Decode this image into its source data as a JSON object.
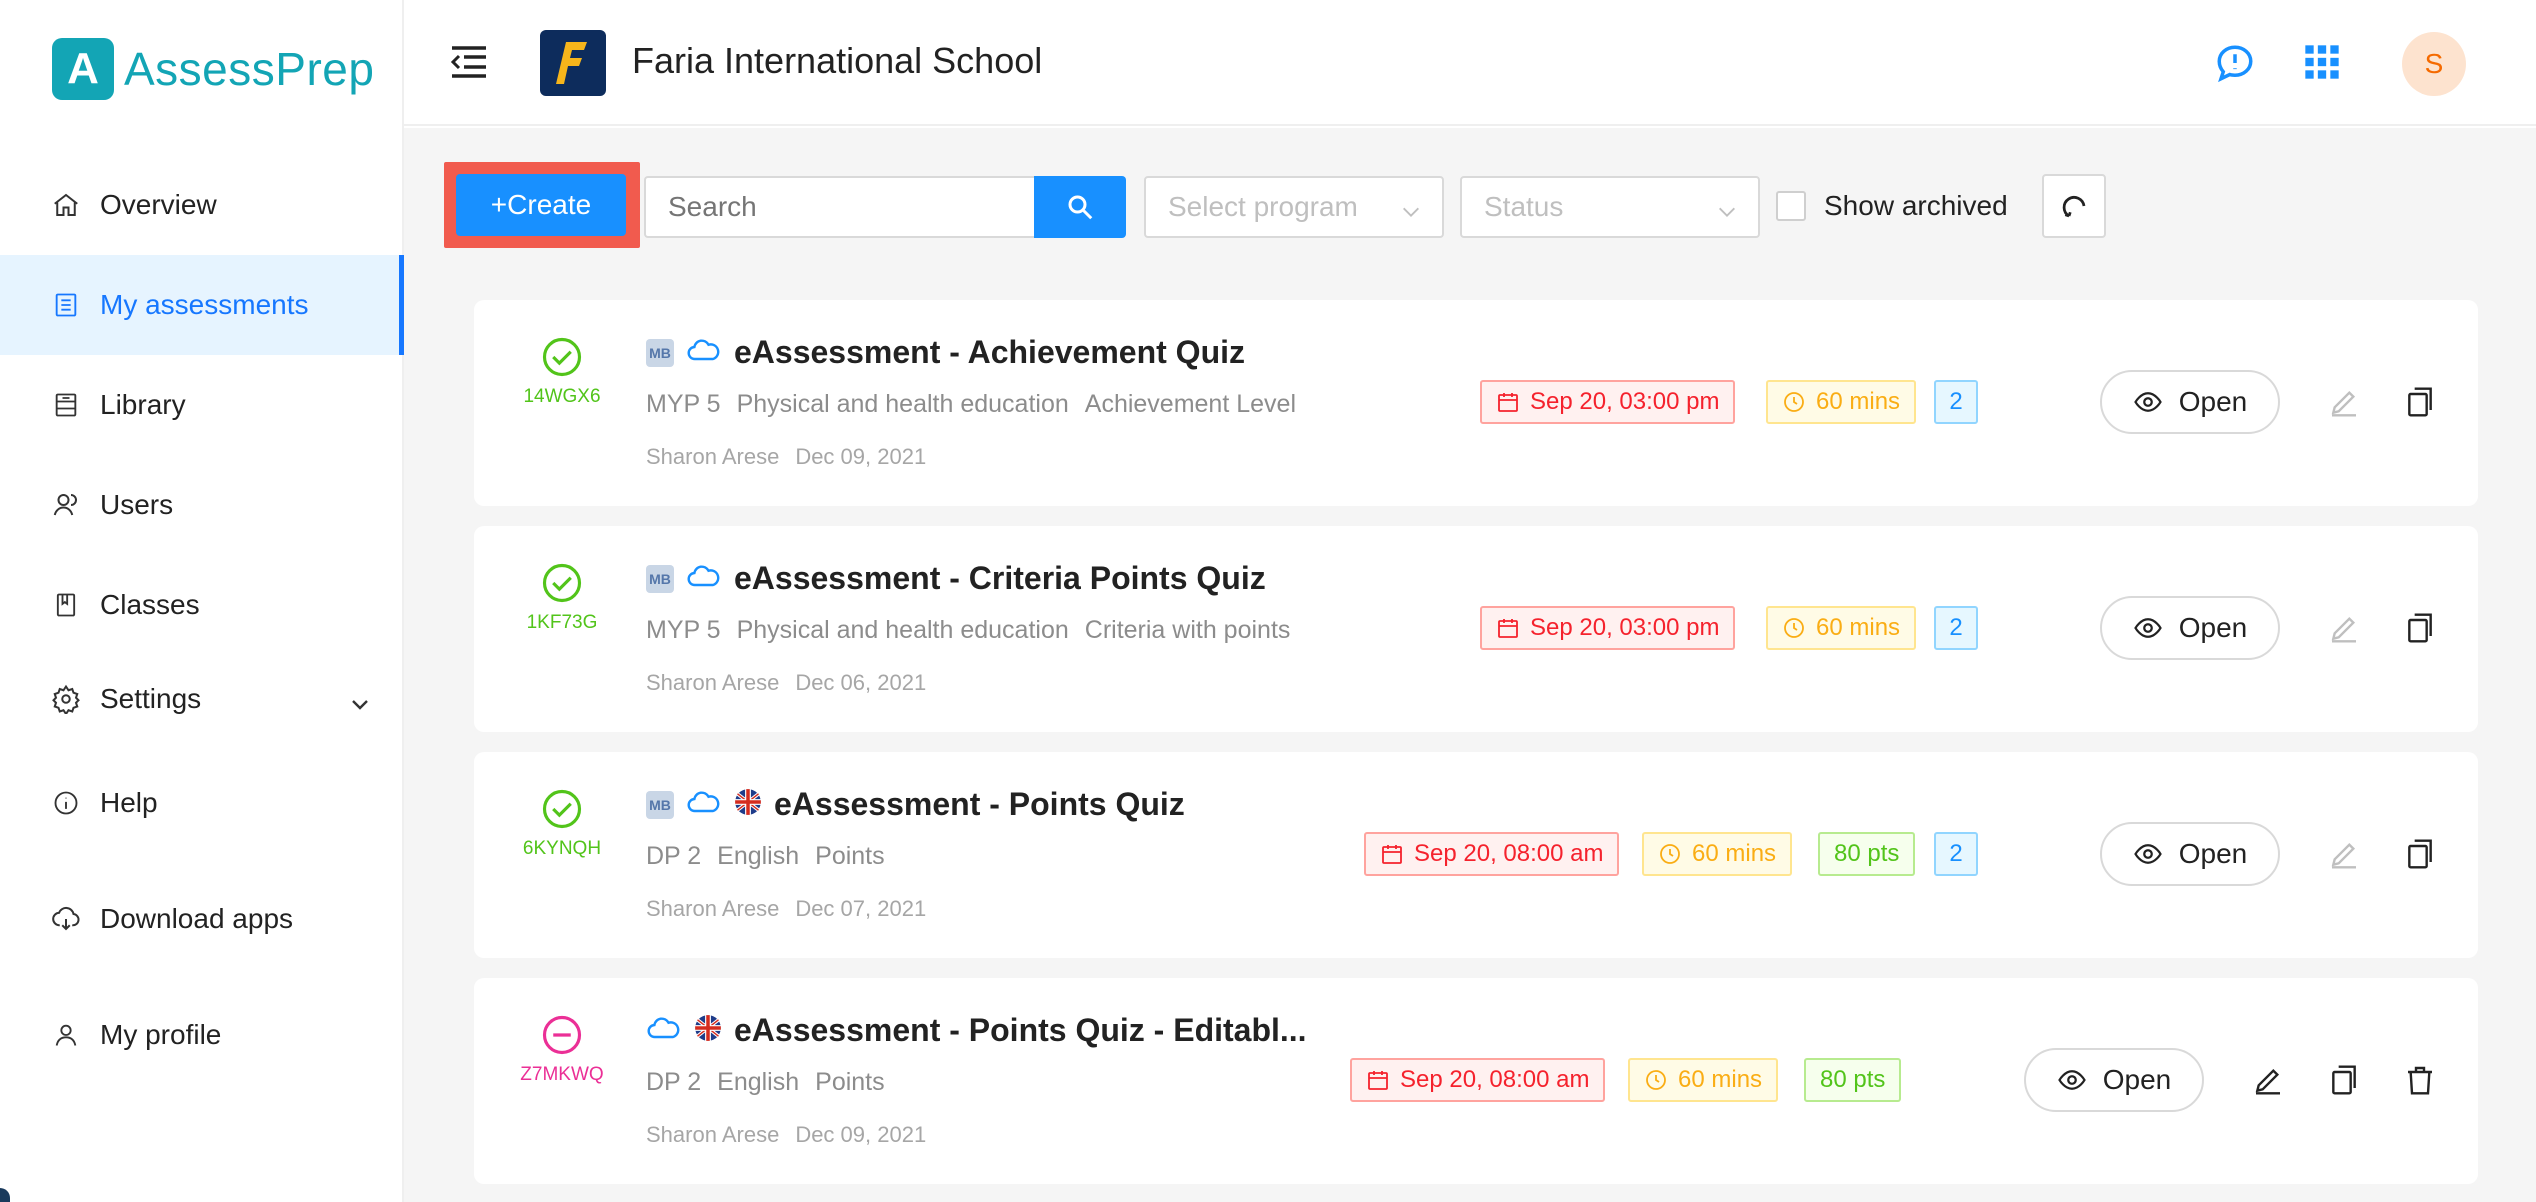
{
  "app": {
    "logo_letter": "A",
    "logo_text": "AssessPrep",
    "brand_color": "#13a5b5",
    "accent_color": "#1890ff"
  },
  "header": {
    "school_name": "Faria International School",
    "school_logo_letter": "F",
    "avatar_initial": "S"
  },
  "sidebar": {
    "items": [
      {
        "label": "Overview",
        "icon": "home-icon",
        "active": false
      },
      {
        "label": "My assessments",
        "icon": "list-icon",
        "active": true
      },
      {
        "label": "Library",
        "icon": "library-icon",
        "active": false
      },
      {
        "label": "Users",
        "icon": "users-icon",
        "active": false
      },
      {
        "label": "Classes",
        "icon": "book-icon",
        "active": false
      },
      {
        "label": "Settings",
        "icon": "gear-icon",
        "active": false
      },
      {
        "label": "Help",
        "icon": "info-icon",
        "active": false
      },
      {
        "label": "Download apps",
        "icon": "cloud-download-icon",
        "active": false
      },
      {
        "label": "My profile",
        "icon": "user-icon",
        "active": false
      }
    ]
  },
  "toolbar": {
    "create_label": "+Create",
    "search_placeholder": "Search",
    "program_placeholder": "Select program",
    "status_placeholder": "Status",
    "show_archived_label": "Show archived"
  },
  "assessments": [
    {
      "status": "published",
      "code": "14WGX6",
      "title": "eAssessment - Achievement Quiz",
      "grade": "MYP 5",
      "subject": "Physical and health education",
      "grading": "Achievement Level",
      "author": "Sharon Arese",
      "created": "Dec 09, 2021",
      "date": "Sep 20, 03:00 pm",
      "duration": "60 mins",
      "count": "2",
      "open_label": "Open"
    },
    {
      "status": "published",
      "code": "1KF73G",
      "title": "eAssessment - Criteria Points Quiz",
      "grade": "MYP 5",
      "subject": "Physical and health education",
      "grading": "Criteria with points",
      "author": "Sharon Arese",
      "created": "Dec 06, 2021",
      "date": "Sep 20, 03:00 pm",
      "duration": "60 mins",
      "count": "2",
      "open_label": "Open"
    },
    {
      "status": "published",
      "code": "6KYNQH",
      "title": "eAssessment - Points Quiz",
      "grade": "DP 2",
      "subject": "English",
      "grading": "Points",
      "author": "Sharon Arese",
      "created": "Dec 07, 2021",
      "date": "Sep 20, 08:00 am",
      "duration": "60 mins",
      "points": "80 pts",
      "count": "2",
      "open_label": "Open"
    },
    {
      "status": "draft",
      "code": "Z7MKWQ",
      "title": "eAssessment - Points Quiz - Editabl...",
      "grade": "DP 2",
      "subject": "English",
      "grading": "Points",
      "author": "Sharon Arese",
      "created": "Dec 09, 2021",
      "date": "Sep 20, 08:00 am",
      "duration": "60 mins",
      "points": "80 pts",
      "open_label": "Open"
    }
  ]
}
